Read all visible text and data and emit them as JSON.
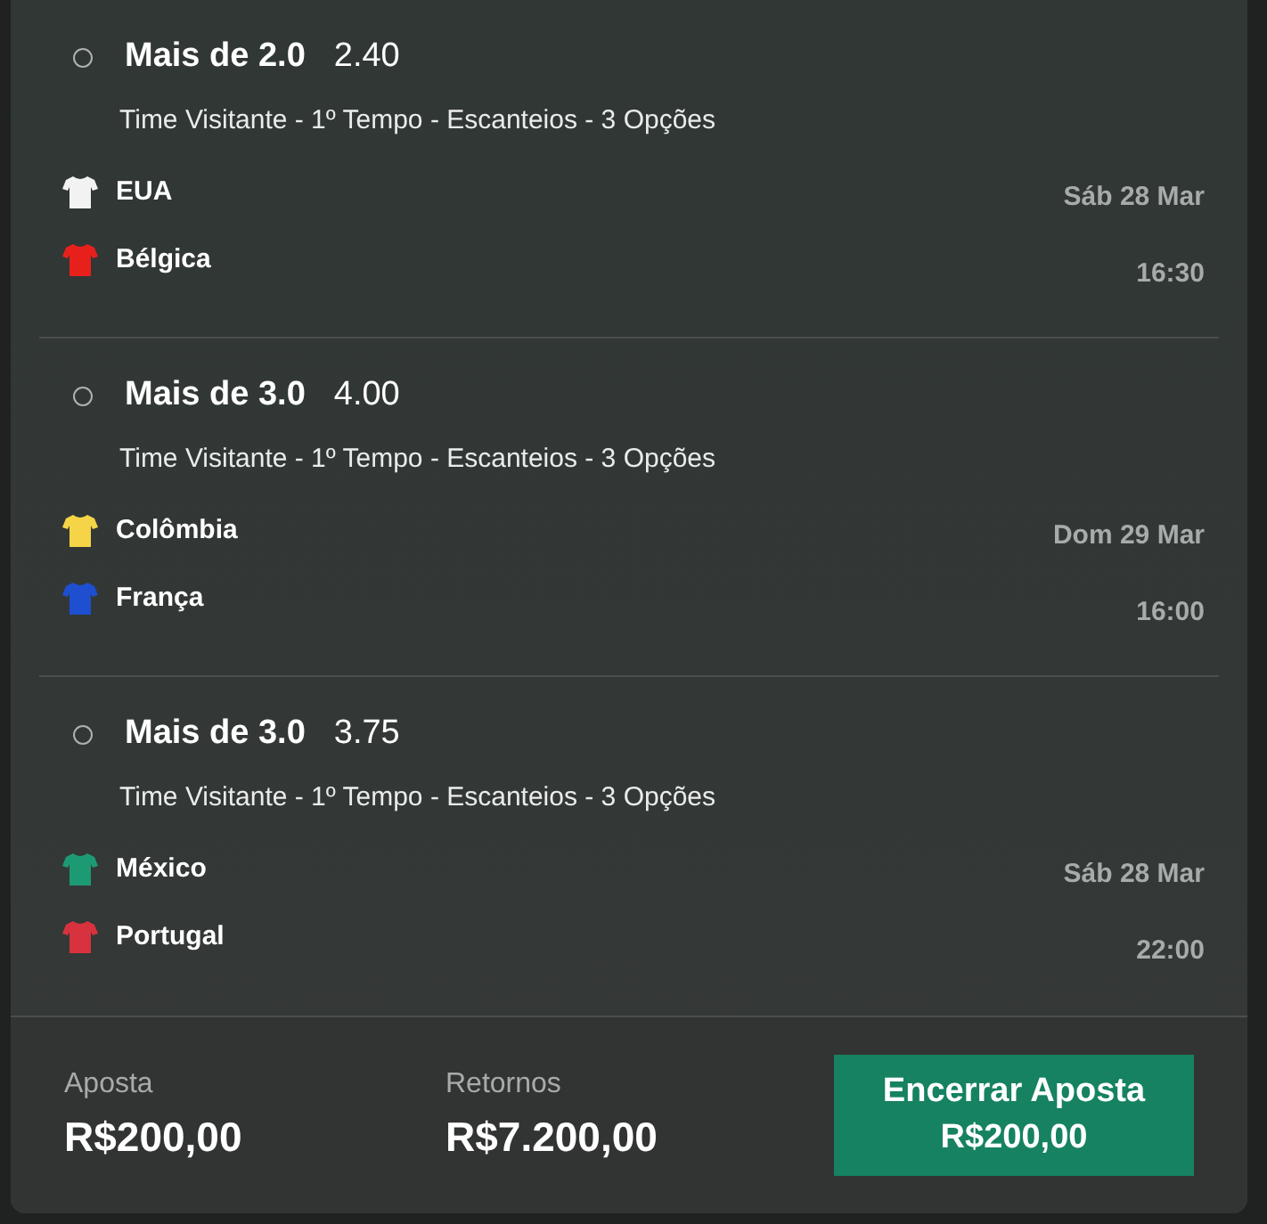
{
  "selections": [
    {
      "selected": false,
      "market": "Mais de 2.0",
      "odds": "2.40",
      "description": "Time Visitante - 1º Tempo - Escanteios - 3 Opções",
      "teams": [
        {
          "name": "EUA",
          "color": "#f2f2f2"
        },
        {
          "name": "Bélgica",
          "color": "#e8201c"
        }
      ],
      "date": "Sáb 28 Mar",
      "time": "16:30"
    },
    {
      "selected": false,
      "market": "Mais de 3.0",
      "odds": "4.00",
      "description": "Time Visitante - 1º Tempo - Escanteios - 3 Opções",
      "teams": [
        {
          "name": "Colômbia",
          "color": "#f5d547"
        },
        {
          "name": "França",
          "color": "#1d4fd0"
        }
      ],
      "date": "Dom 29 Mar",
      "time": "16:00"
    },
    {
      "selected": false,
      "market": "Mais de 3.0",
      "odds": "3.75",
      "description": "Time Visitante - 1º Tempo - Escanteios - 3 Opções",
      "teams": [
        {
          "name": "México",
          "color": "#1c9a74"
        },
        {
          "name": "Portugal",
          "color": "#d8323f"
        }
      ],
      "date": "Sáb 28 Mar",
      "time": "22:00"
    }
  ],
  "footer": {
    "stake_label": "Aposta",
    "stake": "R$200,00",
    "returns_label": "Retornos",
    "returns": "R$7.200,00",
    "cashout_label": "Encerrar Aposta",
    "cashout_amount": "R$200,00"
  }
}
